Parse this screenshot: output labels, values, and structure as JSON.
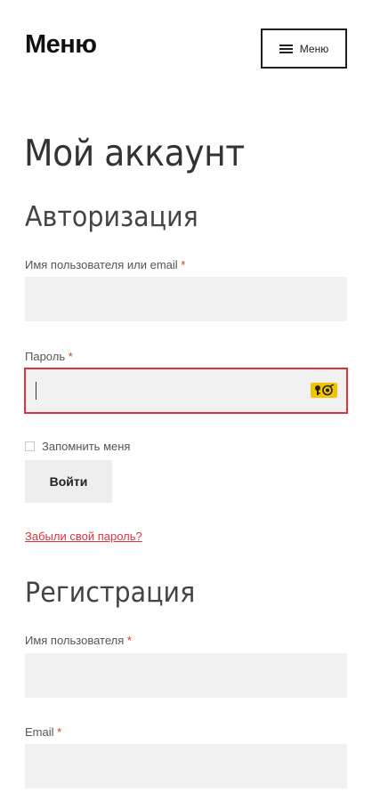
{
  "header": {
    "site_title": "Меню",
    "menu_button_label": "Меню"
  },
  "page": {
    "title": "Мой аккаунт"
  },
  "login": {
    "heading": "Авторизация",
    "username_label": "Имя пользователя или email",
    "username_value": "",
    "password_label": "Пароль",
    "password_value": "",
    "required_mark": "*",
    "remember_label": "Запомнить меня",
    "remember_checked": false,
    "submit_label": "Войти",
    "lost_password_link": "Забыли свой пароль?"
  },
  "register": {
    "heading": "Регистрация",
    "username_label": "Имя пользователя",
    "username_value": "",
    "email_label": "Email",
    "email_value": "",
    "required_mark": "*"
  },
  "icons": {
    "menu": "hamburger-icon",
    "password_manager": "password-manager-icon"
  },
  "colors": {
    "accent": "#e0323a",
    "required": "#d8362e",
    "input_bg": "#f1f1f1",
    "password_manager_bg": "#f5c400"
  }
}
